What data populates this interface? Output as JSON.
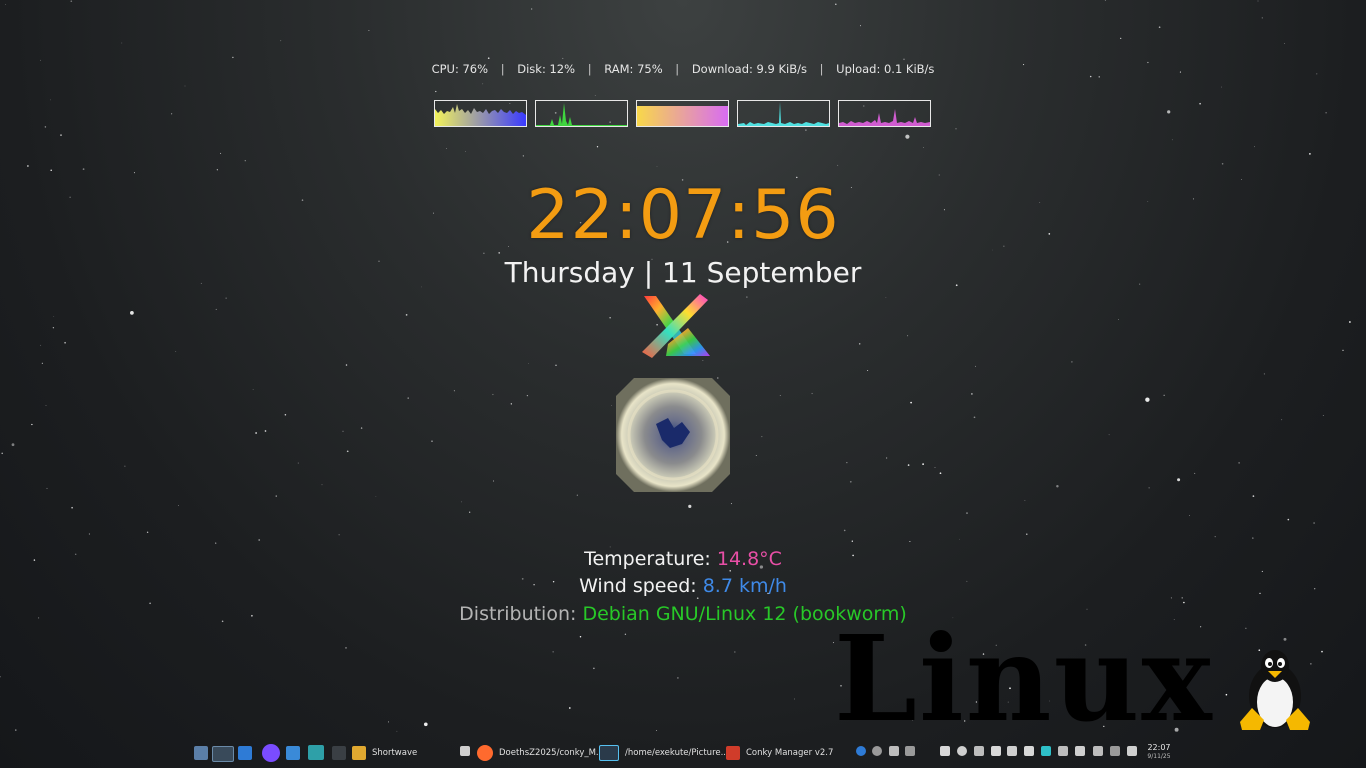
{
  "stats": {
    "cpu": "CPU: 76%",
    "disk": "Disk: 12%",
    "ram": "RAM: 75%",
    "download": "Download: 9.9 KiB/s",
    "upload": "Upload: 0.1 KiB/s",
    "separator": "|"
  },
  "graphs": {
    "cpu_colors": [
      "#f2f25a",
      "#3a3aff"
    ],
    "disk_color": "#3fd63f",
    "ram_colors": [
      "#f8d84a",
      "#d86cf2"
    ],
    "download_color": "#4fe0e0",
    "upload_color": "#d05cd0"
  },
  "clock": {
    "time": "22:07:56",
    "date": "Thursday | 11 September",
    "color": "#f39c12"
  },
  "weather": {
    "temperature_label": "Temperature: ",
    "temperature_value": "14.8°C",
    "wind_label": "Wind speed: ",
    "wind_value": "8.7 km/h",
    "distribution_label": "Distribution: ",
    "distribution_value": "Debian GNU/Linux 12 (bookworm)"
  },
  "watermark": {
    "text": "Linux"
  },
  "taskbar": {
    "items": [
      {
        "label": "Shortwave",
        "icon": "radio-icon"
      },
      {
        "label": "DoethsZ2025/conky_M...",
        "icon": "firefox-icon"
      },
      {
        "label": "/home/exekute/Picture...",
        "icon": "image-viewer-icon"
      },
      {
        "label": "Conky Manager v2.7",
        "icon": "conky-manager-icon"
      }
    ],
    "clock_time": "22:07",
    "clock_date": "9/11/25"
  }
}
